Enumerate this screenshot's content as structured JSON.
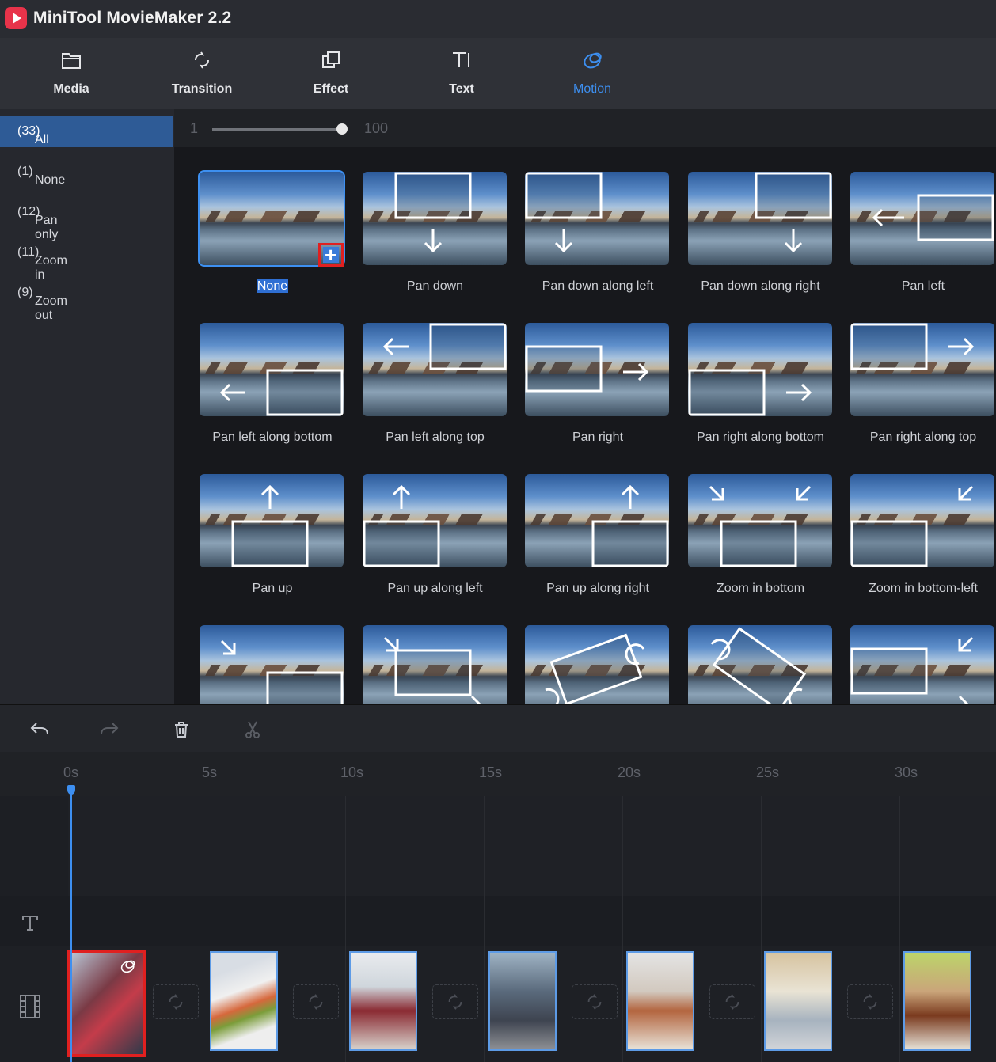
{
  "app": {
    "title": "MiniTool MovieMaker 2.2"
  },
  "toolbar": [
    {
      "label": "Media",
      "icon": "media-folder-icon"
    },
    {
      "label": "Transition",
      "icon": "transition-icon"
    },
    {
      "label": "Effect",
      "icon": "effect-icon"
    },
    {
      "label": "Text",
      "icon": "text-icon"
    },
    {
      "label": "Motion",
      "icon": "motion-icon",
      "active": true
    }
  ],
  "sidebar": {
    "categories": [
      {
        "label": "All",
        "count": "(33)",
        "active": true
      },
      {
        "label": "None",
        "count": "(1)"
      },
      {
        "label": "Pan only",
        "count": "(12)"
      },
      {
        "label": "Zoom in",
        "count": "(11)"
      },
      {
        "label": "Zoom out",
        "count": "(9)"
      }
    ]
  },
  "slider": {
    "min": "1",
    "max": "100",
    "value_fraction": 1.0
  },
  "motions": [
    {
      "label": "None",
      "selected": true
    },
    {
      "label": "Pan down"
    },
    {
      "label": "Pan down along left"
    },
    {
      "label": "Pan down along right"
    },
    {
      "label": "Pan left"
    },
    {
      "label": "Pan left along bottom"
    },
    {
      "label": "Pan left along top"
    },
    {
      "label": "Pan right"
    },
    {
      "label": "Pan right along bottom"
    },
    {
      "label": "Pan right along top"
    },
    {
      "label": "Pan up"
    },
    {
      "label": "Pan up along left"
    },
    {
      "label": "Pan up along right"
    },
    {
      "label": "Zoom in bottom"
    },
    {
      "label": "Zoom in bottom-left"
    },
    {
      "label": ""
    },
    {
      "label": ""
    },
    {
      "label": ""
    },
    {
      "label": ""
    },
    {
      "label": ""
    }
  ],
  "timeline": {
    "ticks": [
      "0s",
      "5s",
      "10s",
      "15s",
      "20s",
      "25s",
      "30s"
    ],
    "clip_count": 7,
    "colors": {
      "accent": "#3d8ff0",
      "highlight": "#e02020"
    }
  }
}
